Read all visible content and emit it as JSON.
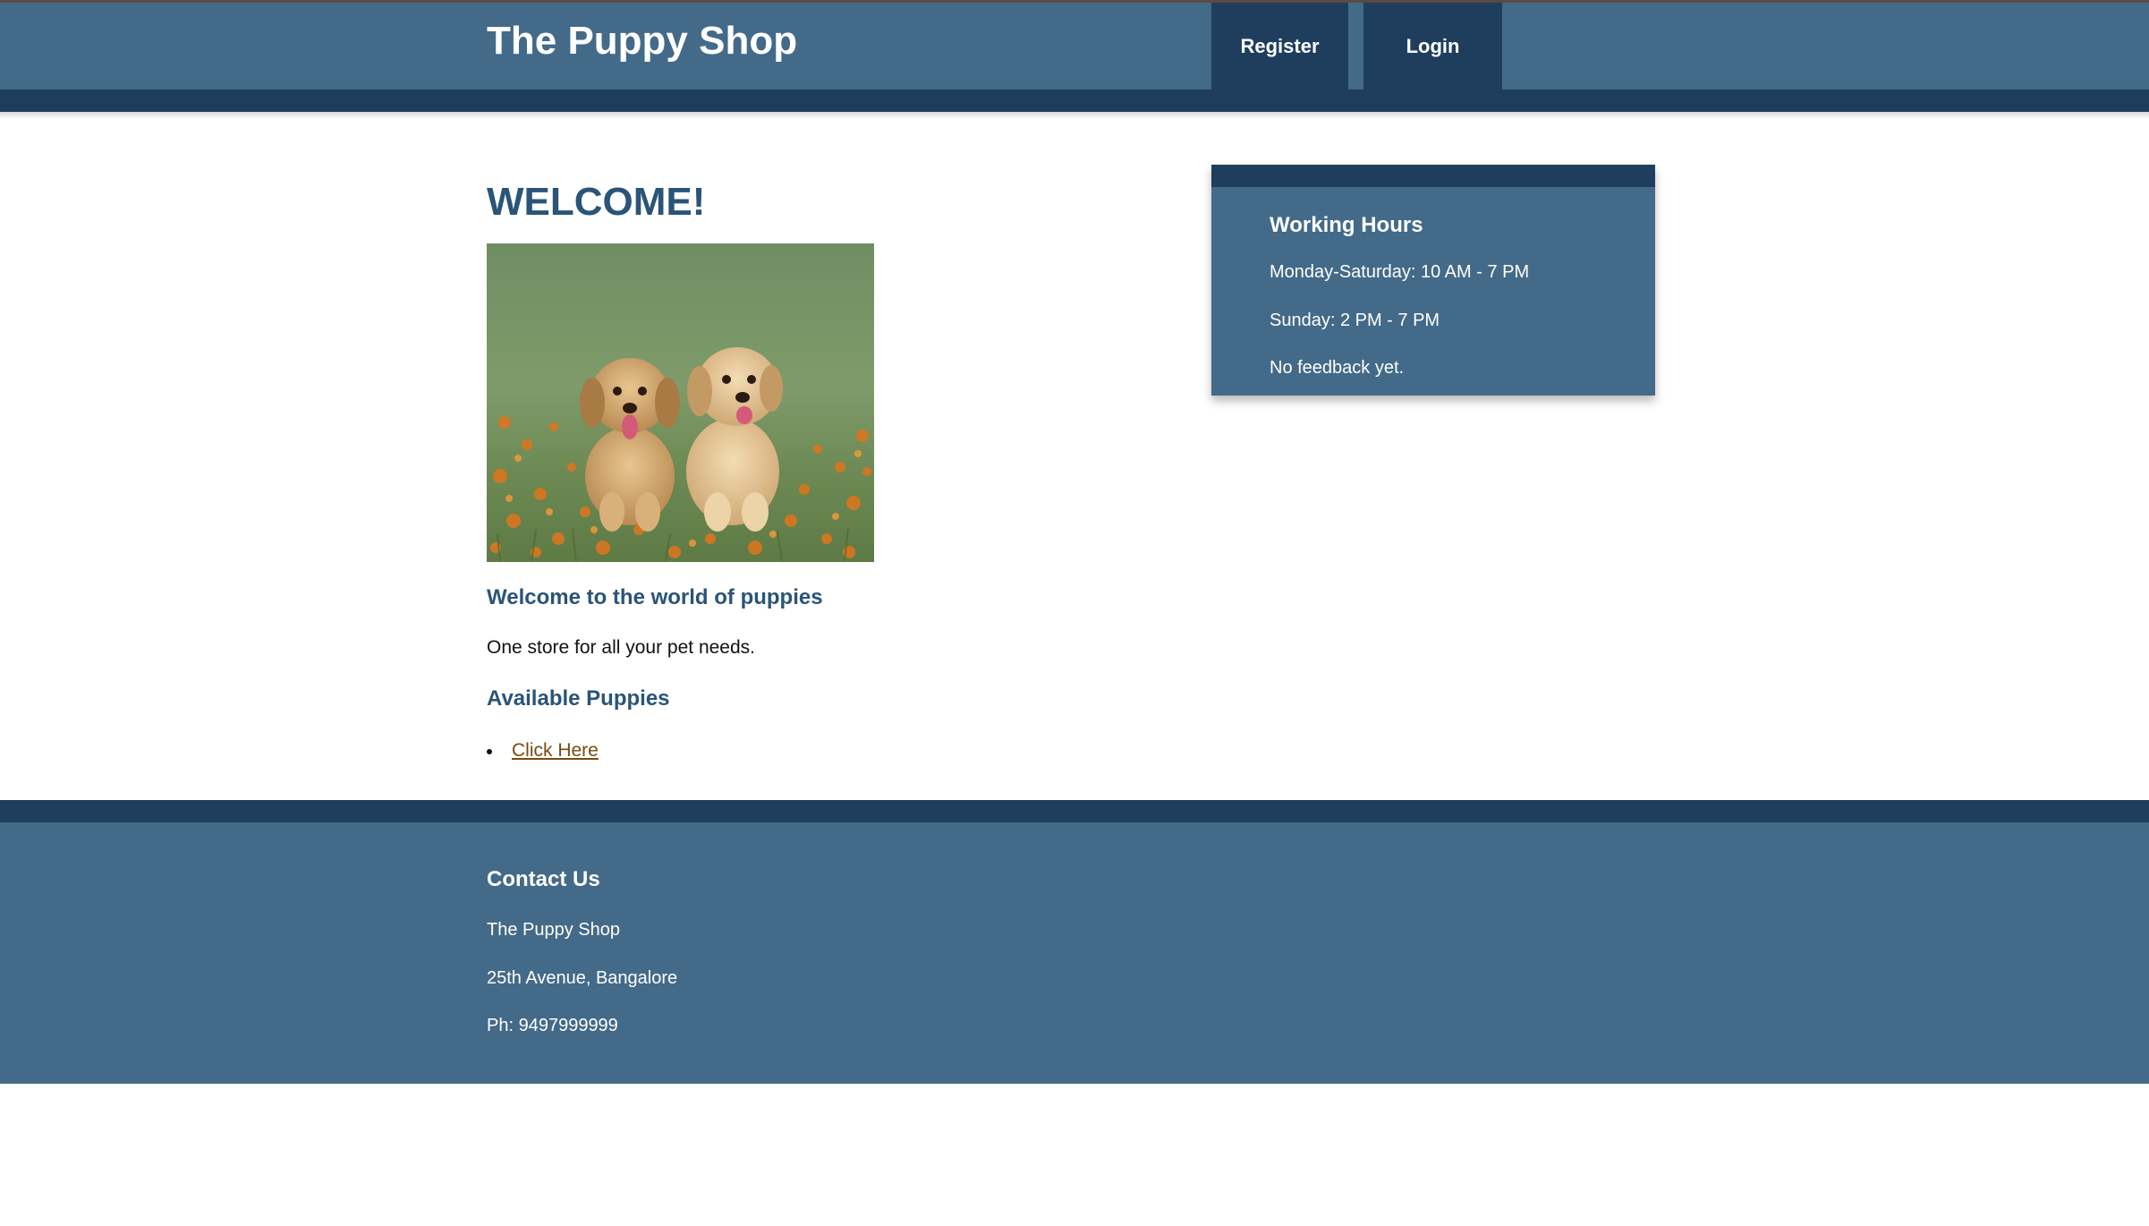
{
  "header": {
    "brand": "The Puppy Shop",
    "nav": {
      "register_label": "Register",
      "login_label": "Login"
    }
  },
  "main": {
    "title": "WELCOME!",
    "subheading": "Welcome to the world of puppies",
    "tagline": "One store for all your pet needs.",
    "available_heading": "Available Puppies",
    "links": [
      "Click Here"
    ]
  },
  "hours_card": {
    "title": "Working Hours",
    "lines": [
      "Monday-Saturday: 10 AM - 7 PM",
      "Sunday: 2 PM - 7 PM",
      "No feedback yet."
    ]
  },
  "footer": {
    "title": "Contact Us",
    "lines": [
      "The Puppy Shop",
      "25th Avenue, Bangalore",
      "Ph: 9497999999"
    ]
  },
  "colors": {
    "header_bg": "#436a88",
    "header_dark": "#1f3e5e",
    "heading_blue": "#2a5478",
    "link_brown": "#7a4a10"
  }
}
